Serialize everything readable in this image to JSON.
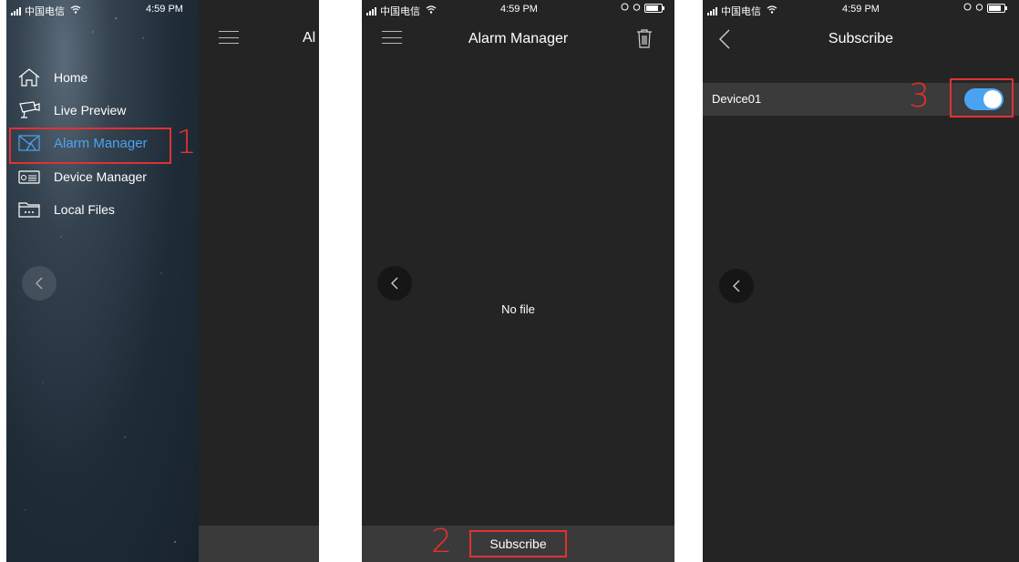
{
  "status_bar": {
    "carrier": "中国电信",
    "time": "4:59 PM"
  },
  "panel1": {
    "menu": [
      {
        "label": "Home",
        "icon": "home-icon"
      },
      {
        "label": "Live Preview",
        "icon": "camera-icon"
      },
      {
        "label": "Alarm Manager",
        "icon": "alarm-mail-icon",
        "active": true
      },
      {
        "label": "Device Manager",
        "icon": "device-icon"
      },
      {
        "label": "Local Files",
        "icon": "folder-icon"
      }
    ],
    "partial_title": "Al",
    "step_number": "1"
  },
  "panel2": {
    "title": "Alarm Manager",
    "empty_text": "No file",
    "subscribe_label": "Subscribe",
    "step_number": "2"
  },
  "panel3": {
    "title": "Subscribe",
    "device_name": "Device01",
    "toggle_on": true,
    "step_number": "3"
  },
  "colors": {
    "accent": "#4aa3f0",
    "annotation_red": "#e03232",
    "background": "#242424"
  }
}
